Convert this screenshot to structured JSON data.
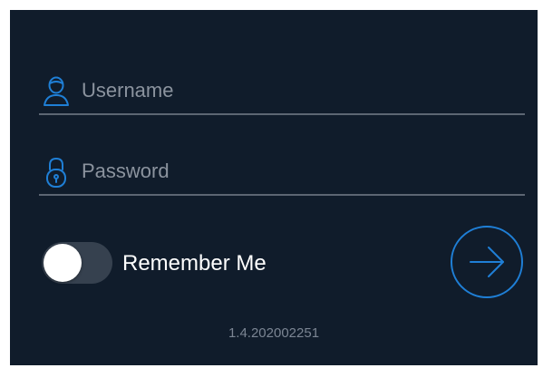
{
  "login": {
    "username": {
      "placeholder": "Username",
      "value": ""
    },
    "password": {
      "placeholder": "Password",
      "value": ""
    },
    "remember_me": {
      "label": "Remember Me",
      "enabled": false
    },
    "version": "1.4.202002251"
  },
  "icons": {
    "username": "user-icon",
    "password": "lock-icon",
    "submit": "arrow-right-icon"
  },
  "colors": {
    "background": "#101c2b",
    "accent": "#1f7fd6",
    "divider": "#5c6673",
    "placeholder": "#8b939e"
  }
}
